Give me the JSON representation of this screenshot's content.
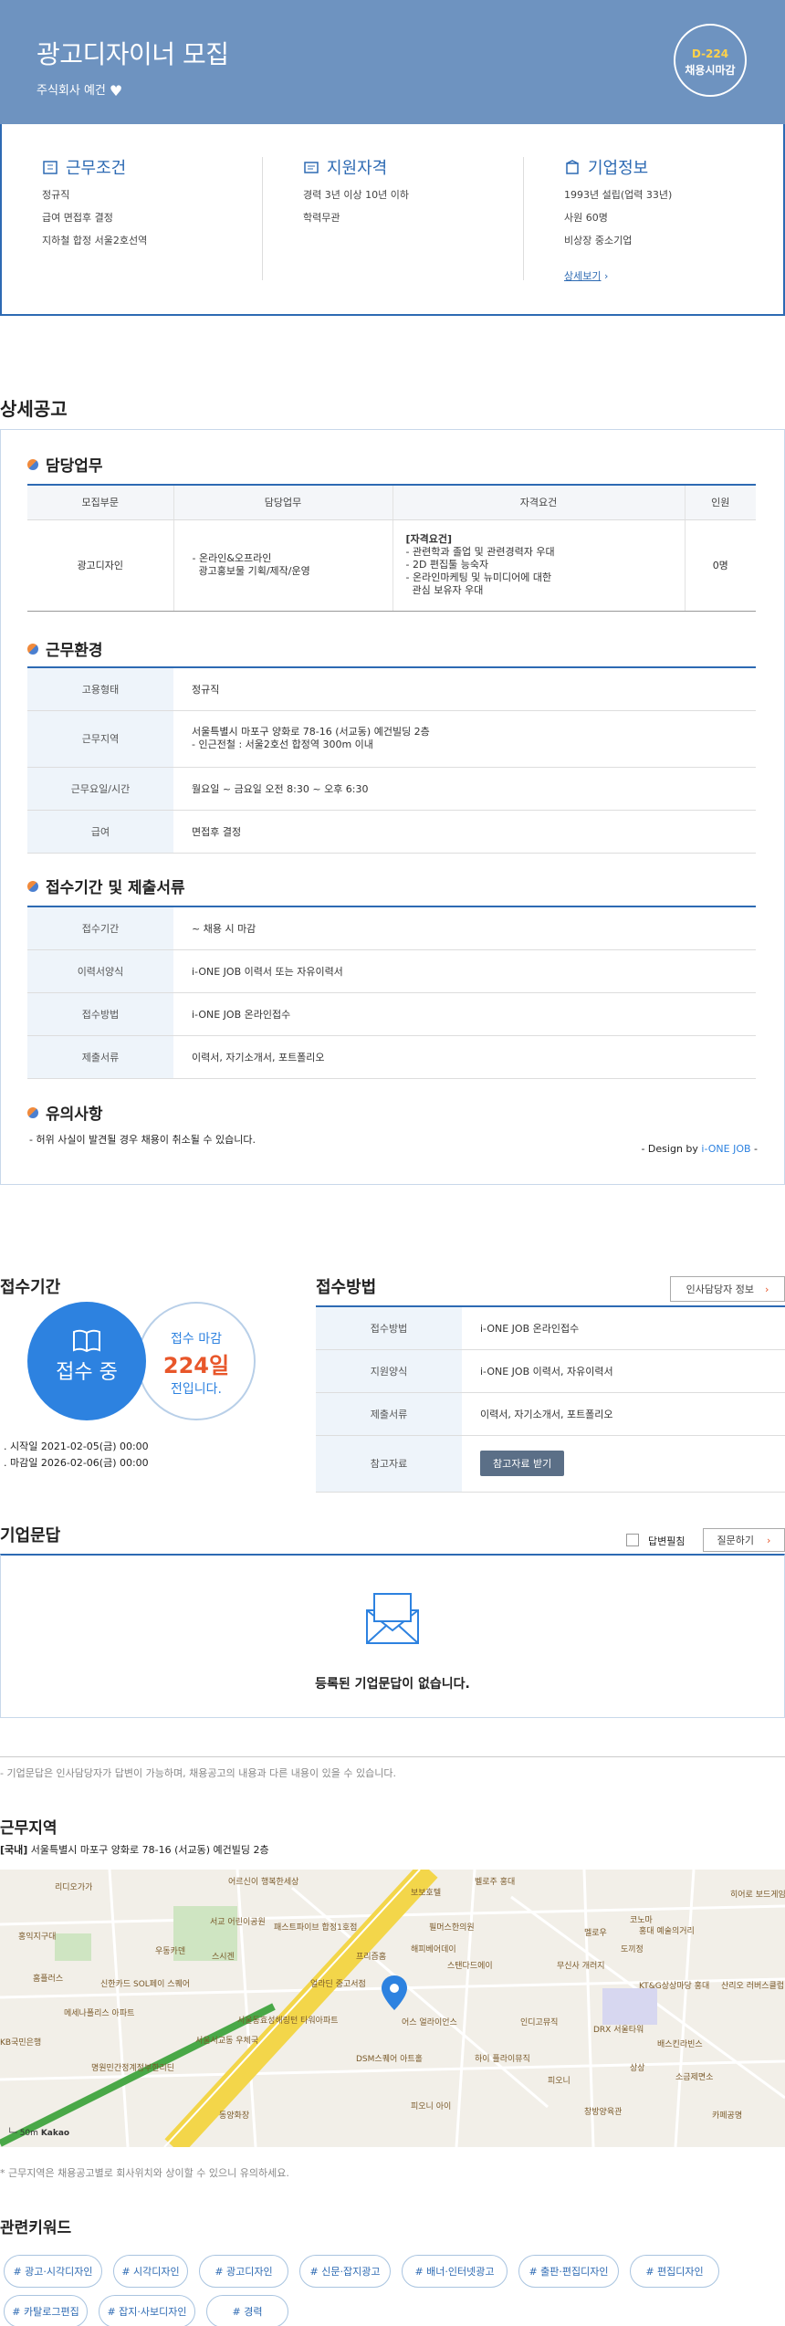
{
  "header": {
    "title": "광고디자이너 모집",
    "company": "주식회사 예건",
    "dday": "D-224",
    "deadline_type": "채용시마감"
  },
  "summary": {
    "conditions": {
      "title": "근무조건",
      "items": [
        "정규직",
        "급여 면접후 결정",
        "지하철 합정 서울2호선역"
      ]
    },
    "qualifications": {
      "title": "지원자격",
      "items": [
        "경력 3년 이상 10년 이하",
        "학력무관"
      ]
    },
    "company": {
      "title": "기업정보",
      "items": [
        "1993년 설립(업력 33년)",
        "사원 60명",
        "비상장 중소기업"
      ],
      "more": "상세보기"
    }
  },
  "detail": {
    "title": "상세공고",
    "duties": {
      "title": "담당업무",
      "headers": [
        "모집부문",
        "담당업무",
        "자격요건",
        "인원"
      ],
      "row": {
        "division": "광고디자인",
        "tasks": [
          "- 온라인&오프라인",
          "  광고홍보물 기획/제작/운영"
        ],
        "req_title": "[자격요건]",
        "reqs": [
          "- 관련학과 졸업 및 관련경력자 우대",
          "- 2D 편집툴 능숙자",
          "- 온라인마케팅 및 뉴미디어에 대한",
          "  관심 보유자 우대"
        ],
        "count": "0명"
      }
    },
    "environment": {
      "title": "근무환경",
      "rows": [
        {
          "k": "고용형태",
          "v": [
            "정규직"
          ]
        },
        {
          "k": "근무지역",
          "v": [
            "서울특별시 마포구 양화로 78-16 (서교동) 예건빌딩 2층",
            "- 인근전철 : 서울2호선 합정역 300m 이내"
          ]
        },
        {
          "k": "근무요일/시간",
          "v": [
            "월요일 ~ 금요일 오전 8:30 ~ 오후 6:30"
          ]
        },
        {
          "k": "급여",
          "v": [
            "면접후 결정"
          ]
        }
      ]
    },
    "period": {
      "title": "접수기간 및 제출서류",
      "rows": [
        {
          "k": "접수기간",
          "v": "~ 채용 시 마감"
        },
        {
          "k": "이력서양식",
          "v": "i-ONE JOB 이력서 또는 자유이력서"
        },
        {
          "k": "접수방법",
          "v": "i-ONE JOB 온라인접수"
        },
        {
          "k": "제출서류",
          "v": "이력서, 자기소개서, 포트폴리오"
        }
      ]
    },
    "notice": {
      "title": "유의사항",
      "text": "- 허위 사실이 발견될 경우 채용이 취소될 수 있습니다.",
      "design_prefix": "- Design by ",
      "design_brand": "i-ONE JOB",
      "design_suffix": " -"
    }
  },
  "apply": {
    "period_title": "접수기간",
    "status": "접수 중",
    "deadline_label": "접수 마감",
    "days_left": "224일",
    "days_suffix": "전입니다.",
    "start": "시작일 2021-02-05(금) 00:00",
    "end": "마감일 2026-02-06(금) 00:00",
    "method_title": "접수방법",
    "contact_btn": "인사담당자 정보",
    "rows": [
      {
        "k": "접수방법",
        "v": "i-ONE JOB 온라인접수"
      },
      {
        "k": "지원양식",
        "v": "i-ONE JOB 이력서, 자유이력서"
      },
      {
        "k": "제출서류",
        "v": "이력서, 자기소개서, 포트폴리오"
      },
      {
        "k": "참고자료",
        "v": "참고자료 받기"
      }
    ]
  },
  "qa": {
    "title": "기업문답",
    "answered": "답변필침",
    "ask_btn": "질문하기",
    "empty": "등록된 기업문답이 없습니다.",
    "note": "- 기업문답은 인사담당자가 답변이 가능하며, 채용공고의 내용과 다른 내용이 있을 수 있습니다."
  },
  "location": {
    "title": "근무지역",
    "tag": "[국내]",
    "address": "서울특별시 마포구 양화로 78-16 (서교동) 예건빌딩 2층",
    "note": "* 근무지역은 채용공고별로 회사위치와 상이할 수 있으니 유의하세요.",
    "map_labels": [
      "리디오가가",
      "어르신이 행복한세상",
      "보보호텔",
      "벨로주 홍대",
      "히어로 보드게임",
      "홍대 예술의거리",
      "홍익지구대",
      "서교 어린이공원",
      "패스트파이브 합정1호점",
      "필머스한의원",
      "멜로우",
      "코노마",
      "도끼정",
      "우동카덴",
      "스시겐",
      "프리즘홈",
      "해피베어데이",
      "스탠다드에이",
      "무신사 개러지",
      "얼라딘 중고서점",
      "홈플러스",
      "신한카드 SOL페이 스퀘어",
      "메세나폴리스 아파트",
      "서울동효성해링턴 타워아파트",
      "어스 얼라이언스",
      "인디고뮤직",
      "DRX 서울타워",
      "KT&G상상마당 홍대",
      "산리오 러버스클럽",
      "KB국민은행",
      "서울서교동 우체국",
      "DSM스퀘어 아트홀",
      "하이 플라이뮤직",
      "배스킨라빈스",
      "명원민간정계정부한리딘",
      "피오니",
      "상상",
      "소금제면소",
      "동양화장",
      "피오니 아이",
      "창방양육관",
      "카페공명"
    ],
    "scale": "50m",
    "map_logo": "Kakao"
  },
  "keywords": {
    "title": "관련키워드",
    "items": [
      "# 광고·시각디자인",
      "# 시각디자인",
      "# 광고디자인",
      "# 신문·잡지광고",
      "# 배너·인터넷광고",
      "# 출판·편집디자인",
      "# 편집디자인",
      "# 카탈로그편집",
      "# 잡지·사보디자인",
      "# 경력"
    ]
  },
  "colors": {
    "brand": "#2d6ab3",
    "header_bg": "#6e93c0",
    "accent": "#e8562a"
  }
}
